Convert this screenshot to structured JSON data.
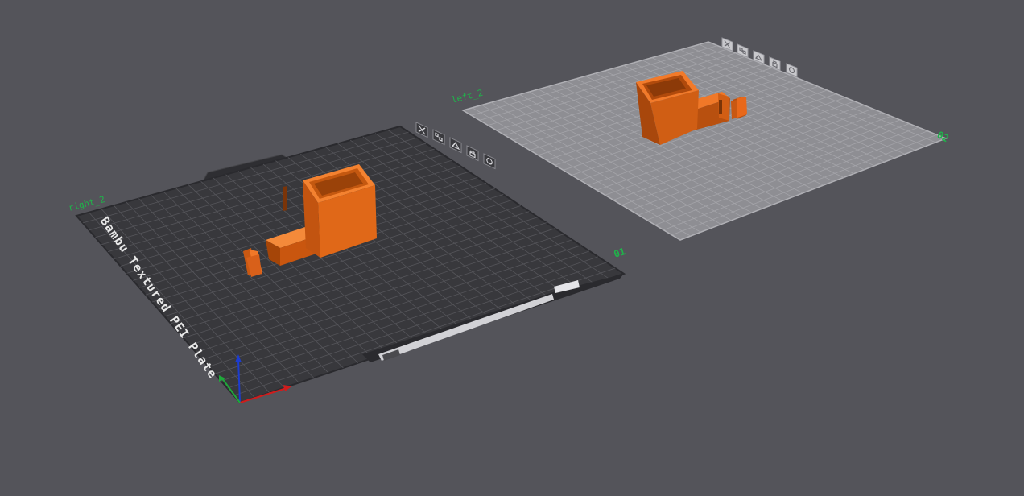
{
  "plates": [
    {
      "name": "right_2",
      "number": "01",
      "bed_text": "Bambu Textured PEI Plate",
      "colors": {
        "surface": "#38383c",
        "grid": "#55555a",
        "edge": "#2a2a2e"
      },
      "toolbar_icons": [
        "close-icon",
        "arrange-icon",
        "orient-icon",
        "lock-icon",
        "settings-icon"
      ]
    },
    {
      "name": "left_2",
      "number": "02",
      "colors": {
        "surface": "#8e8e93",
        "grid": "#a4a4a9",
        "edge": "#b0b0b5"
      },
      "toolbar_icons": [
        "close-icon",
        "arrange-icon",
        "orient-icon",
        "lock-icon",
        "settings-icon"
      ]
    }
  ],
  "model_color": "#e8681a",
  "axes_colors": {
    "x": "#d01c1c",
    "y": "#1fa83a",
    "z": "#1c3cd0"
  }
}
